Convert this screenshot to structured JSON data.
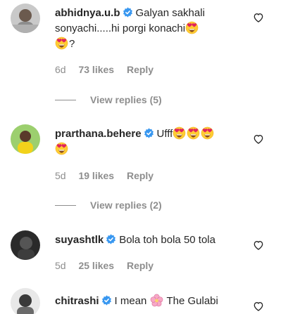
{
  "comments": [
    {
      "username": "abhidnya.u.b",
      "text_line1": "Galyan sakhali",
      "text_line2": "sonyachi.....hi porgi konachi",
      "text_line3_suffix": "?",
      "age": "6d",
      "likes": "73 likes",
      "reply": "Reply",
      "view_replies": "View replies (5)"
    },
    {
      "username": "prarthana.behere",
      "text": "Ufff",
      "age": "5d",
      "likes": "19 likes",
      "reply": "Reply",
      "view_replies": "View replies (2)"
    },
    {
      "username": "suyashtlk",
      "text": "Bola toh bola 50 tola",
      "age": "5d",
      "likes": "25 likes",
      "reply": "Reply"
    },
    {
      "username": "chitrashi",
      "text_before": "I mean",
      "text_after": "The Gulabi"
    }
  ],
  "colors": {
    "text": "#262626",
    "meta": "#8e8e8e",
    "verified": "#3897f0",
    "emoji_face": "#ffcc33",
    "emoji_heart": "#e0245e"
  }
}
